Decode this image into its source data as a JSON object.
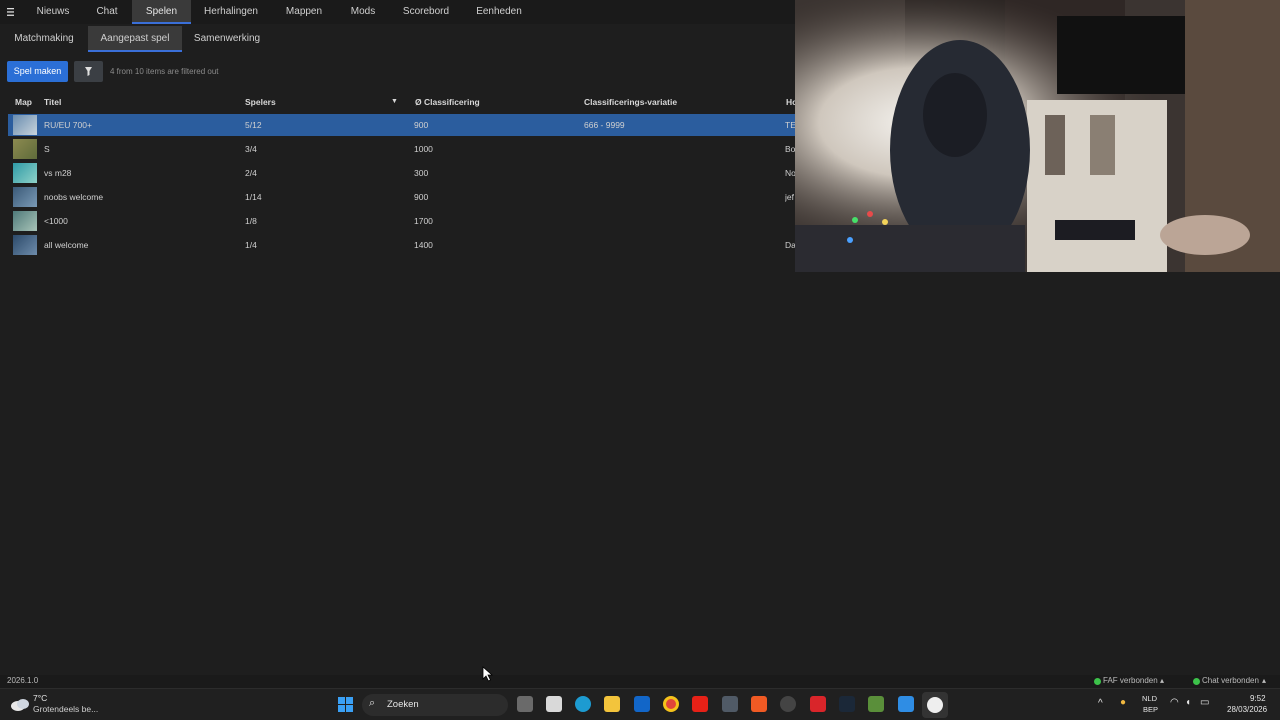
{
  "top_nav": {
    "menu_icon": "hamburger-icon",
    "items": [
      "Nieuws",
      "Chat",
      "Spelen",
      "Herhalingen",
      "Mappen",
      "Mods",
      "Scorebord",
      "Eenheden"
    ],
    "active": "Spelen"
  },
  "sub_nav": {
    "items": [
      "Matchmaking",
      "Aangepast spel",
      "Samenwerking"
    ],
    "active": "Aangepast spel"
  },
  "toolbar": {
    "create_button": "Spel maken",
    "filter_icon": "filter-icon",
    "filter_note": "4 from 10 items are filtered out"
  },
  "table": {
    "columns": [
      "Map",
      "Titel",
      "Spelers",
      "Ø Classificering",
      "Classificerings-variatie",
      "Ho"
    ],
    "sort_indicator": "▼",
    "rows": [
      {
        "title": "RU/EU 700+",
        "players": "5/12",
        "rating": "900",
        "range": "666 - 9999",
        "host": "TE",
        "selected": true
      },
      {
        "title": "S",
        "players": "3/4",
        "rating": "1000",
        "range": "",
        "host": "Bo",
        "selected": false
      },
      {
        "title": "vs m28",
        "players": "2/4",
        "rating": "300",
        "range": "",
        "host": "No",
        "selected": false
      },
      {
        "title": "noobs welcome",
        "players": "1/14",
        "rating": "900",
        "range": "",
        "host": "jef",
        "selected": false
      },
      {
        "title": "<1000",
        "players": "1/8",
        "rating": "1700",
        "range": "",
        "host": "",
        "selected": false
      },
      {
        "title": "all welcome",
        "players": "1/4",
        "rating": "1400",
        "range": "",
        "host": "Da",
        "selected": false
      }
    ]
  },
  "status_bar": {
    "version": "2026.1.0",
    "faf_status": "FAF verbonden",
    "chat_status": "Chat verbonden",
    "status_color": "#3cc24a"
  },
  "taskbar": {
    "weather_temp": "7°C",
    "weather_desc": "Grotendeels be...",
    "search_placeholder": "Zoeken",
    "lang_top": "NLD",
    "lang_bottom": "BEP",
    "time": "9:52",
    "date": "28/03/2026"
  },
  "colors": {
    "accent": "#2b6fd6",
    "selected_row": "#2b5d9e",
    "background": "#1e1e1e"
  }
}
